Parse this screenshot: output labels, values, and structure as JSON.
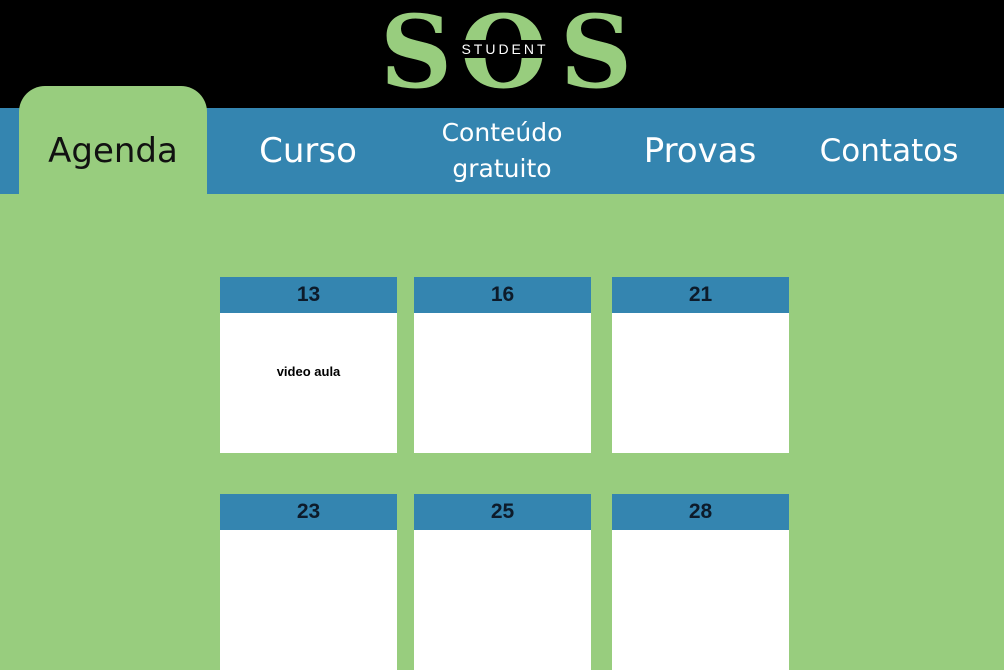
{
  "logo": {
    "letters": [
      "S",
      "O",
      "S"
    ],
    "subtitle": "STUDENT"
  },
  "nav": {
    "tabs": [
      {
        "id": "agenda",
        "label": "Agenda",
        "active": true
      },
      {
        "id": "curso",
        "label": "Curso",
        "active": false
      },
      {
        "id": "conteudo",
        "label_line1": "Conteúdo",
        "label_line2": "gratuito",
        "active": false
      },
      {
        "id": "provas",
        "label": "Provas",
        "active": false
      },
      {
        "id": "contatos",
        "label": "Contatos",
        "active": false
      }
    ]
  },
  "calendar": {
    "days": [
      {
        "day": "13",
        "event": "video aula"
      },
      {
        "day": "16",
        "event": ""
      },
      {
        "day": "21",
        "event": ""
      },
      {
        "day": "23",
        "event": ""
      },
      {
        "day": "25",
        "event": ""
      },
      {
        "day": "28",
        "event": ""
      }
    ]
  },
  "colors": {
    "background": "#98cd7e",
    "header": "#000000",
    "navbar": "#3485b0",
    "logo": "#98cd7e",
    "card": "#ffffff"
  }
}
